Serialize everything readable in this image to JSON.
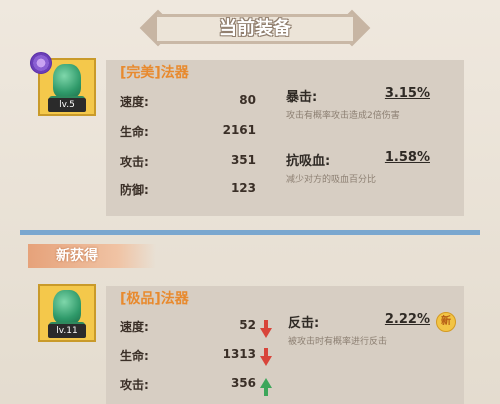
{
  "header": {
    "title": "当前装备"
  },
  "current_item": {
    "level": "lv.5",
    "quality": "[完美]",
    "type": "法器",
    "stats": [
      {
        "label": "速度:",
        "value": "80"
      },
      {
        "label": "生命:",
        "value": "2161"
      },
      {
        "label": "攻击:",
        "value": "351"
      },
      {
        "label": "防御:",
        "value": "123"
      }
    ],
    "specials": [
      {
        "label": "暴击:",
        "value": "3.15%",
        "desc": "攻击有概率攻击造成2倍伤害"
      },
      {
        "label": "抗吸血:",
        "value": "1.58%",
        "desc": "减少对方的吸血百分比"
      }
    ]
  },
  "new_section": {
    "title": "新获得"
  },
  "new_item": {
    "level": "lv.11",
    "quality": "[极品]",
    "type": "法器",
    "stats": [
      {
        "label": "速度:",
        "value": "52",
        "trend": "down"
      },
      {
        "label": "生命:",
        "value": "1313",
        "trend": "down"
      },
      {
        "label": "攻击:",
        "value": "356",
        "trend": "up"
      }
    ],
    "specials": [
      {
        "label": "反击:",
        "value": "2.22%",
        "desc": "被攻击时有概率进行反击",
        "badge": "新"
      }
    ]
  },
  "colors": {
    "quality_text": "#e88a2e",
    "divider": "#7aa7cf",
    "arrow_down": "#d8443a",
    "arrow_up": "#3da65a"
  },
  "icons": {
    "item": "green-pagoda-gem-icon",
    "current_marker": "purple-swirl-icon",
    "trend_down": "red-down-arrow-icon",
    "trend_up": "green-up-arrow-icon"
  }
}
